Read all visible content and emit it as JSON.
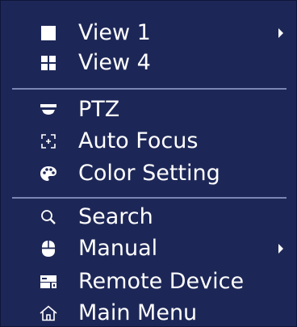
{
  "menu": {
    "items": [
      {
        "label": "View 1",
        "icon": "square-icon",
        "submenu": true
      },
      {
        "label": "View 4",
        "icon": "quad-grid-icon",
        "submenu": false
      },
      {
        "label": "PTZ",
        "icon": "ptz-camera-icon",
        "submenu": false
      },
      {
        "label": "Auto Focus",
        "icon": "focus-icon",
        "submenu": false
      },
      {
        "label": "Color Setting",
        "icon": "palette-icon",
        "submenu": false
      },
      {
        "label": "Search",
        "icon": "search-icon",
        "submenu": false
      },
      {
        "label": "Manual",
        "icon": "mouse-icon",
        "submenu": true
      },
      {
        "label": "Remote Device",
        "icon": "remote-device-icon",
        "submenu": false
      },
      {
        "label": "Main Menu",
        "icon": "home-icon",
        "submenu": false
      }
    ]
  },
  "colors": {
    "background": "#1d2757",
    "separator": "#7c86b4",
    "text": "#ffffff"
  }
}
